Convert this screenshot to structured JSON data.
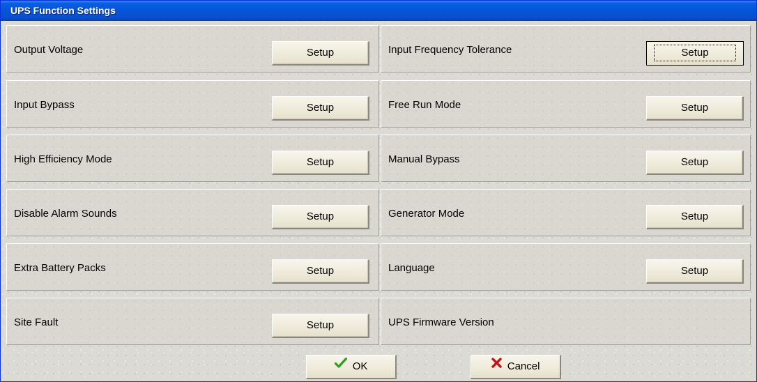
{
  "window": {
    "title": "UPS Function Settings"
  },
  "settings": {
    "left": [
      {
        "label": "Output Voltage",
        "button": "Setup"
      },
      {
        "label": "Input Bypass",
        "button": "Setup"
      },
      {
        "label": "High Efficiency Mode",
        "button": "Setup"
      },
      {
        "label": "Disable Alarm Sounds",
        "button": "Setup"
      },
      {
        "label": "Extra Battery Packs",
        "button": "Setup"
      },
      {
        "label": "Site Fault",
        "button": "Setup"
      }
    ],
    "right": [
      {
        "label": "Input Frequency Tolerance",
        "button": "Setup"
      },
      {
        "label": "Free Run Mode",
        "button": "Setup"
      },
      {
        "label": "Manual Bypass",
        "button": "Setup"
      },
      {
        "label": "Generator Mode",
        "button": "Setup"
      },
      {
        "label": "Language",
        "button": "Setup"
      },
      {
        "label": "UPS Firmware Version"
      }
    ]
  },
  "footer": {
    "ok_label": "OK",
    "cancel_label": "Cancel"
  },
  "icons": {
    "ok": "checkmark-icon",
    "cancel": "x-icon"
  },
  "colors": {
    "titlebar": "#0554d8",
    "ok_check": "#2f9e1a",
    "cancel_x": "#c0161a"
  }
}
